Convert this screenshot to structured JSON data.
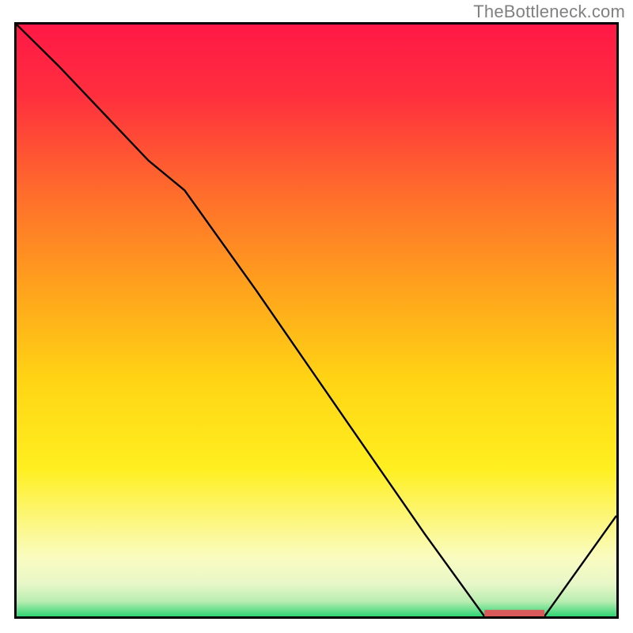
{
  "watermark": "TheBottleneck.com",
  "colors": {
    "border": "#000000",
    "line": "#000000",
    "watermark": "#808080",
    "gradient_stops": [
      {
        "offset": 0.0,
        "color": "#ff1846"
      },
      {
        "offset": 0.12,
        "color": "#ff2f3e"
      },
      {
        "offset": 0.28,
        "color": "#ff6b2c"
      },
      {
        "offset": 0.45,
        "color": "#ffa41c"
      },
      {
        "offset": 0.6,
        "color": "#ffd414"
      },
      {
        "offset": 0.75,
        "color": "#ffef20"
      },
      {
        "offset": 0.9,
        "color": "#fafcc0"
      },
      {
        "offset": 0.945,
        "color": "#e8f7c8"
      },
      {
        "offset": 0.975,
        "color": "#b8edb0"
      },
      {
        "offset": 1.0,
        "color": "#2ed573"
      }
    ],
    "marker": "#d85a5a"
  },
  "chart_data": {
    "type": "line",
    "title": "",
    "xlabel": "",
    "ylabel": "",
    "xlim": [
      0,
      100
    ],
    "ylim": [
      0,
      100
    ],
    "x": [
      0,
      7,
      22,
      28,
      40,
      55,
      68,
      78,
      82,
      88,
      100
    ],
    "values": [
      100,
      93,
      77,
      72,
      55,
      33,
      14,
      0,
      0,
      0,
      17
    ],
    "flat_segment": {
      "x_start": 78,
      "x_end": 88,
      "y": 0
    },
    "marker_bar": {
      "x_start": 78,
      "x_end": 88,
      "y": 0.5,
      "thickness": 1.2
    }
  }
}
